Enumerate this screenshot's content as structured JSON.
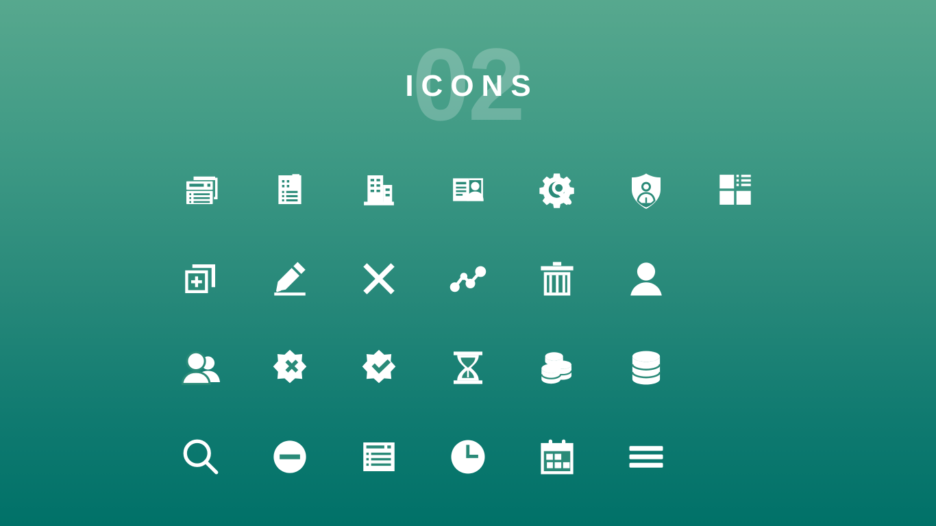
{
  "slide": {
    "number_watermark": "02",
    "title": "ICONS",
    "background": {
      "gradient_top": "#57a88e",
      "gradient_mid": "#28897a",
      "gradient_bottom": "#007168"
    },
    "icon_color": "#ffffff"
  },
  "icon_rows": [
    {
      "row": 1,
      "icons": [
        {
          "name": "stacked-list-window-icon",
          "label": "Stacked list window"
        },
        {
          "name": "bookmarked-document-icon",
          "label": "Bookmarked document"
        },
        {
          "name": "office-building-icon",
          "label": "Office building"
        },
        {
          "name": "contact-card-icon",
          "label": "Contact card"
        },
        {
          "name": "gear-wrench-icon",
          "label": "Settings maintenance"
        },
        {
          "name": "shield-person-icon",
          "label": "Shield with person"
        },
        {
          "name": "dashboard-layout-icon",
          "label": "Dashboard layout"
        }
      ]
    },
    {
      "row": 2,
      "icons": [
        {
          "name": "add-square-icon",
          "label": "Add new item"
        },
        {
          "name": "pencil-edit-icon",
          "label": "Edit"
        },
        {
          "name": "close-x-icon",
          "label": "Close"
        },
        {
          "name": "network-nodes-icon",
          "label": "Network nodes"
        },
        {
          "name": "trash-delete-icon",
          "label": "Delete"
        },
        {
          "name": "user-person-icon",
          "label": "User"
        }
      ]
    },
    {
      "row": 3,
      "icons": [
        {
          "name": "users-group-icon",
          "label": "User group"
        },
        {
          "name": "badge-reject-icon",
          "label": "Rejected badge"
        },
        {
          "name": "badge-approve-icon",
          "label": "Approved badge"
        },
        {
          "name": "hourglass-icon",
          "label": "Pending hourglass"
        },
        {
          "name": "database-stack-icon",
          "label": "Multiple databases"
        },
        {
          "name": "database-icon",
          "label": "Database"
        }
      ]
    },
    {
      "row": 4,
      "icons": [
        {
          "name": "search-icon",
          "label": "Search"
        },
        {
          "name": "minus-circle-icon",
          "label": "Remove"
        },
        {
          "name": "list-table-icon",
          "label": "List table"
        },
        {
          "name": "clock-icon",
          "label": "Clock"
        },
        {
          "name": "calendar-icon",
          "label": "Calendar"
        },
        {
          "name": "hamburger-menu-icon",
          "label": "Menu"
        }
      ]
    }
  ]
}
